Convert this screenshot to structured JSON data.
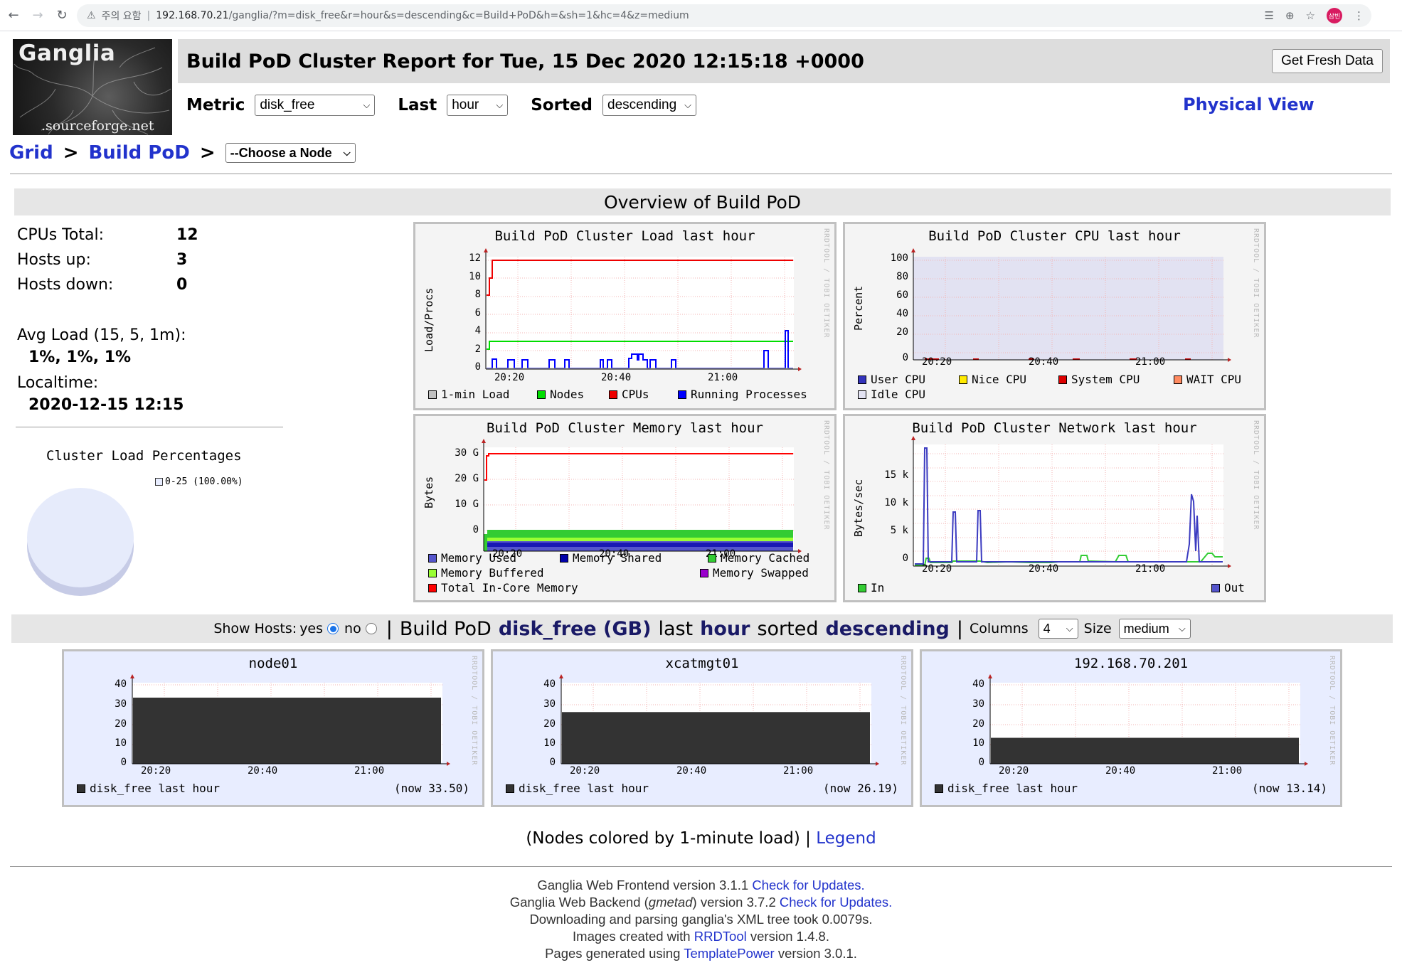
{
  "browser": {
    "security_label": "주의 요함",
    "url_host": "192.168.70.21",
    "url_path": "/ganglia/?m=disk_free&r=hour&s=descending&c=Build+PoD&h=&sh=1&hc=4&z=medium",
    "profile_initials": "삼빈"
  },
  "logo": {
    "title": "Ganglia",
    "subtitle": ".sourceforge.net"
  },
  "header": {
    "title": "Build PoD Cluster Report for Tue, 15 Dec 2020 12:15:18 +0000",
    "fresh_button": "Get Fresh Data",
    "metric_label": "Metric",
    "metric_value": "disk_free",
    "last_label": "Last",
    "last_value": "hour",
    "sorted_label": "Sorted",
    "sorted_value": "descending",
    "physical_view": "Physical View"
  },
  "breadcrumb": {
    "grid": "Grid",
    "cluster": "Build PoD",
    "sep": ">",
    "node_select": "--Choose a Node"
  },
  "overview": {
    "heading": "Overview of Build PoD",
    "cpus_label": "CPUs Total:",
    "cpus_value": "12",
    "hosts_up_label": "Hosts up:",
    "hosts_up_value": "3",
    "hosts_down_label": "Hosts down:",
    "hosts_down_value": "0",
    "avg_load_label": "Avg Load (15, 5, 1m):",
    "avg_load_value": "1%, 1%, 1%",
    "localtime_label": "Localtime:",
    "localtime_value": "2020-12-15 12:15",
    "cluster_load_title": "Cluster Load Percentages",
    "cluster_load_legend": "0-25 (100.00%)"
  },
  "rrd_tag": "RRDTOOL / TOBI OETIKER",
  "graphs": {
    "load": {
      "title": "Build PoD Cluster Load last hour",
      "ylabel": "Load/Procs",
      "yticks": [
        "12",
        "10",
        "8",
        "6",
        "4",
        "2",
        "0"
      ],
      "xticks": [
        "20:20",
        "20:40",
        "21:00"
      ],
      "legend": [
        {
          "label": "1-min Load",
          "color": "#c0c0c0"
        },
        {
          "label": "Nodes",
          "color": "#00dd00"
        },
        {
          "label": "CPUs",
          "color": "#ee0000"
        },
        {
          "label": "Running Processes",
          "color": "#0000ff"
        }
      ]
    },
    "cpu": {
      "title": "Build PoD Cluster CPU last hour",
      "ylabel": "Percent",
      "yticks": [
        "100",
        "80",
        "60",
        "40",
        "20",
        "0"
      ],
      "xticks": [
        "20:20",
        "20:40",
        "21:00"
      ],
      "legend": [
        {
          "label": "User CPU",
          "color": "#3333bb"
        },
        {
          "label": "Nice CPU",
          "color": "#ffea00"
        },
        {
          "label": "System CPU",
          "color": "#dd0000"
        },
        {
          "label": "WAIT CPU",
          "color": "#ff8a60"
        },
        {
          "label": "Idle CPU",
          "color": "#e2e2f2"
        }
      ]
    },
    "memory": {
      "title": "Build PoD Cluster Memory last hour",
      "ylabel": "Bytes",
      "yticks": [
        "30 G",
        "20 G",
        "10 G",
        "0"
      ],
      "xticks": [
        "20:20",
        "20:40",
        "21:00"
      ],
      "legend": [
        {
          "label": "Memory Used",
          "color": "#5555cc"
        },
        {
          "label": "Memory Shared",
          "color": "#0000aa"
        },
        {
          "label": "Memory Cached",
          "color": "#33cc33"
        },
        {
          "label": "Memory Buffered",
          "color": "#99ff33"
        },
        {
          "label": "Memory Swapped",
          "color": "#9900cc"
        },
        {
          "label": "Total In-Core Memory",
          "color": "#ff0000"
        }
      ]
    },
    "network": {
      "title": "Build PoD Cluster Network last hour",
      "ylabel": "Bytes/sec",
      "yticks": [
        "15 k",
        "10 k",
        "5 k",
        "0"
      ],
      "xticks": [
        "20:20",
        "20:40",
        "21:00"
      ],
      "legend": [
        {
          "label": "In",
          "color": "#33cc33"
        },
        {
          "label": "Out",
          "color": "#5555cc"
        }
      ]
    }
  },
  "hosts_bar": {
    "show_hosts": "Show Hosts:",
    "yes": "yes",
    "no": "no",
    "pipe": "|",
    "cluster": "Build PoD",
    "metric": "disk_free (GB)",
    "last_word": "last",
    "range": "hour",
    "sorted_word": "sorted",
    "order": "descending",
    "columns_label": "Columns",
    "columns_value": "4",
    "size_label": "Size",
    "size_value": "medium"
  },
  "hosts": [
    {
      "name": "node01",
      "legend": "disk_free last hour",
      "now": "(now 33.50)",
      "value": 33.5
    },
    {
      "name": "xcatmgt01",
      "legend": "disk_free last hour",
      "now": "(now 26.19)",
      "value": 26.19
    },
    {
      "name": "192.168.70.201",
      "legend": "disk_free last hour",
      "now": "(now 13.14)",
      "value": 13.14
    }
  ],
  "host_yticks": [
    "40",
    "30",
    "20",
    "10",
    "0"
  ],
  "host_xticks": [
    "20:20",
    "20:40",
    "21:00"
  ],
  "footer": {
    "note_prefix": "(Nodes colored by 1-minute load) |",
    "legend_link": "Legend",
    "line1_text": "Ganglia Web Frontend version 3.1.1",
    "line1_link": "Check for Updates.",
    "line2_text_a": "Ganglia Web Backend (",
    "line2_em": "gmetad",
    "line2_text_b": ") version 3.7.2",
    "line2_link": "Check for Updates.",
    "line3": "Downloading and parsing ganglia's XML tree took 0.0079s.",
    "line4_a": "Images created with",
    "line4_link": "RRDTool",
    "line4_b": "version 1.4.8.",
    "line5_a": "Pages generated using",
    "line5_link": "TemplatePower",
    "line5_b": "version 3.0.1."
  }
}
